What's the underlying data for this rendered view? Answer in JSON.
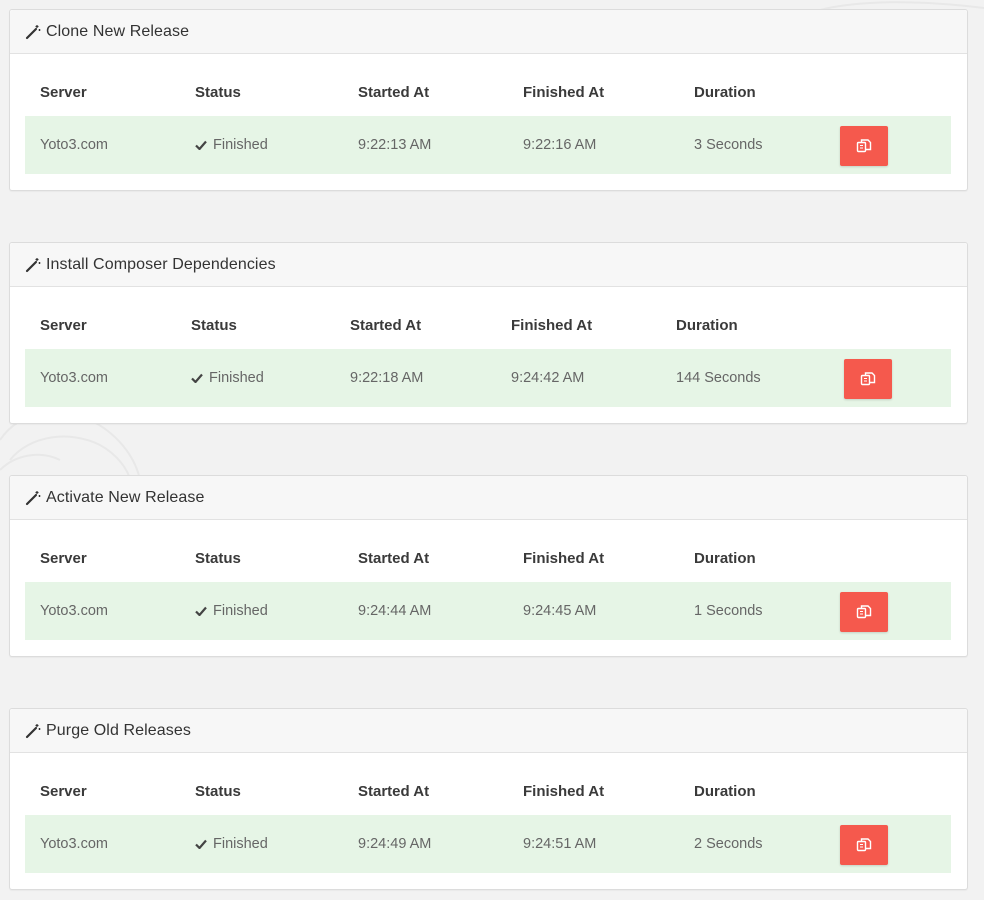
{
  "columns": {
    "server": "Server",
    "status": "Status",
    "started_at": "Started At",
    "finished_at": "Finished At",
    "duration": "Duration"
  },
  "colors": {
    "row_success": "#e6f5e6",
    "action_button": "#f5594d",
    "page_background": "#f2f2f2"
  },
  "panels": [
    {
      "title": "Clone New Release",
      "icon": "magic-wand-icon",
      "row": {
        "server": "Yoto3.com",
        "status": "Finished",
        "status_icon": "check-icon",
        "started_at": "9:22:13 AM",
        "finished_at": "9:22:16 AM",
        "duration": "3 Seconds",
        "action_icon": "copy-icon"
      }
    },
    {
      "title": "Install Composer Dependencies",
      "icon": "magic-wand-icon",
      "row": {
        "server": "Yoto3.com",
        "status": "Finished",
        "status_icon": "check-icon",
        "started_at": "9:22:18 AM",
        "finished_at": "9:24:42 AM",
        "duration": "144 Seconds",
        "action_icon": "copy-icon"
      }
    },
    {
      "title": "Activate New Release",
      "icon": "magic-wand-icon",
      "row": {
        "server": "Yoto3.com",
        "status": "Finished",
        "status_icon": "check-icon",
        "started_at": "9:24:44 AM",
        "finished_at": "9:24:45 AM",
        "duration": "1 Seconds",
        "action_icon": "copy-icon"
      }
    },
    {
      "title": "Purge Old Releases",
      "icon": "magic-wand-icon",
      "row": {
        "server": "Yoto3.com",
        "status": "Finished",
        "status_icon": "check-icon",
        "started_at": "9:24:49 AM",
        "finished_at": "9:24:51 AM",
        "duration": "2 Seconds",
        "action_icon": "copy-icon"
      }
    }
  ]
}
